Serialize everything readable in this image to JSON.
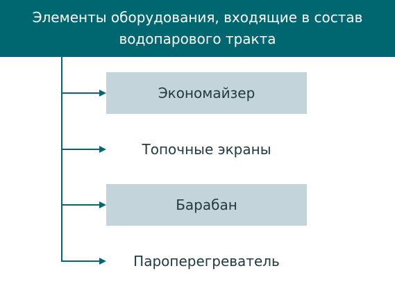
{
  "header": {
    "line1": "Элементы оборудования, входящие в состав",
    "line2": "водопарового тракта"
  },
  "items": [
    {
      "label": "Экономайзер",
      "shaded": true
    },
    {
      "label": "Топочные экраны",
      "shaded": false
    },
    {
      "label": "Барабан",
      "shaded": true
    },
    {
      "label": "Пароперегреватель",
      "shaded": false
    }
  ],
  "colors": {
    "header_bg": "#006770",
    "header_text": "#ffffff",
    "connector": "#006770",
    "item_shaded_bg": "#c3d4da",
    "item_text": "#22393f"
  }
}
